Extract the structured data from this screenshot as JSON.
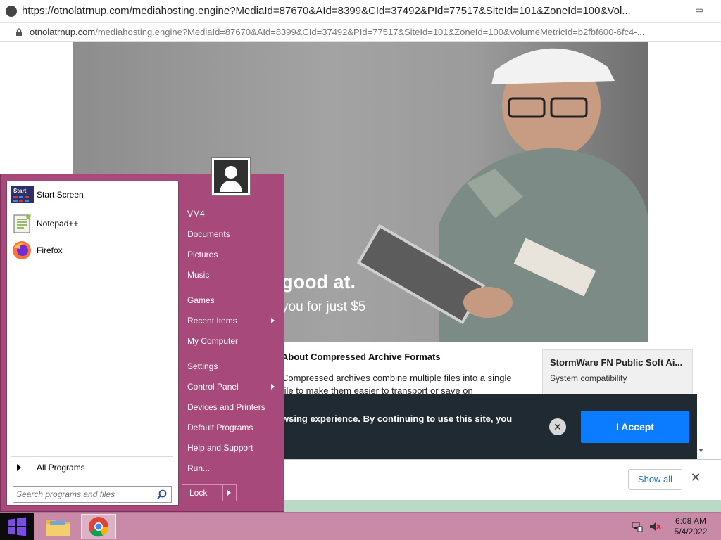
{
  "browser": {
    "title": "https://otnolatrnup.com/mediahosting.engine?MediaId=87670&AId=8399&CId=37492&PId=77517&SiteId=101&ZoneId=100&Vol...",
    "url_domain": "otnolatrnup.com",
    "url_rest": "/mediahosting.engine?MediaId=87670&AId=8399&CId=37492&PId=77517&SiteId=101&ZoneId=100&VolumeMetricId=b2fbf600-6fc4-..."
  },
  "page": {
    "ad_headline": "good at.",
    "ad_sub": "you for just $5",
    "article_title": "About Compressed Archive Formats",
    "article_body": "Compressed archives combine multiple files into a single file to make them easier to transport or save on",
    "sidebar_card_title": "StormWare FN Public Soft Ai...",
    "sidebar_card_sub": "System compatibility",
    "cookie_text": "wsing experience. By continuing to use this site, you",
    "cookie_close": "✕",
    "cookie_accept": "I Accept",
    "show_all": "Show all",
    "download_close": "✕"
  },
  "start_menu": {
    "left_items": [
      {
        "label": "Start Screen",
        "icon": "start-screen-icon"
      },
      {
        "label": "Notepad++",
        "icon": "notepadpp-icon"
      },
      {
        "label": "Firefox",
        "icon": "firefox-icon"
      }
    ],
    "all_programs": "All Programs",
    "search_placeholder": "Search programs and files",
    "right_items": [
      {
        "label": "VM4"
      },
      {
        "label": "Documents"
      },
      {
        "label": "Pictures"
      },
      {
        "label": "Music"
      },
      {
        "label": "Games"
      },
      {
        "label": "Recent Items",
        "submenu": true
      },
      {
        "label": "My Computer"
      },
      {
        "label": "Settings"
      },
      {
        "label": "Control Panel",
        "submenu": true
      },
      {
        "label": "Devices and Printers"
      },
      {
        "label": "Default Programs"
      },
      {
        "label": "Help and Support"
      },
      {
        "label": "Run..."
      }
    ],
    "lock": "Lock"
  },
  "taskbar": {
    "time": "6:08 AM",
    "date": "5/4/2022"
  },
  "colors": {
    "start_menu_bg": "#a8497c",
    "taskbar_bg": "#c98aa8",
    "accept_button": "#0b7cff",
    "cookie_bar_bg": "#1f2a33"
  }
}
